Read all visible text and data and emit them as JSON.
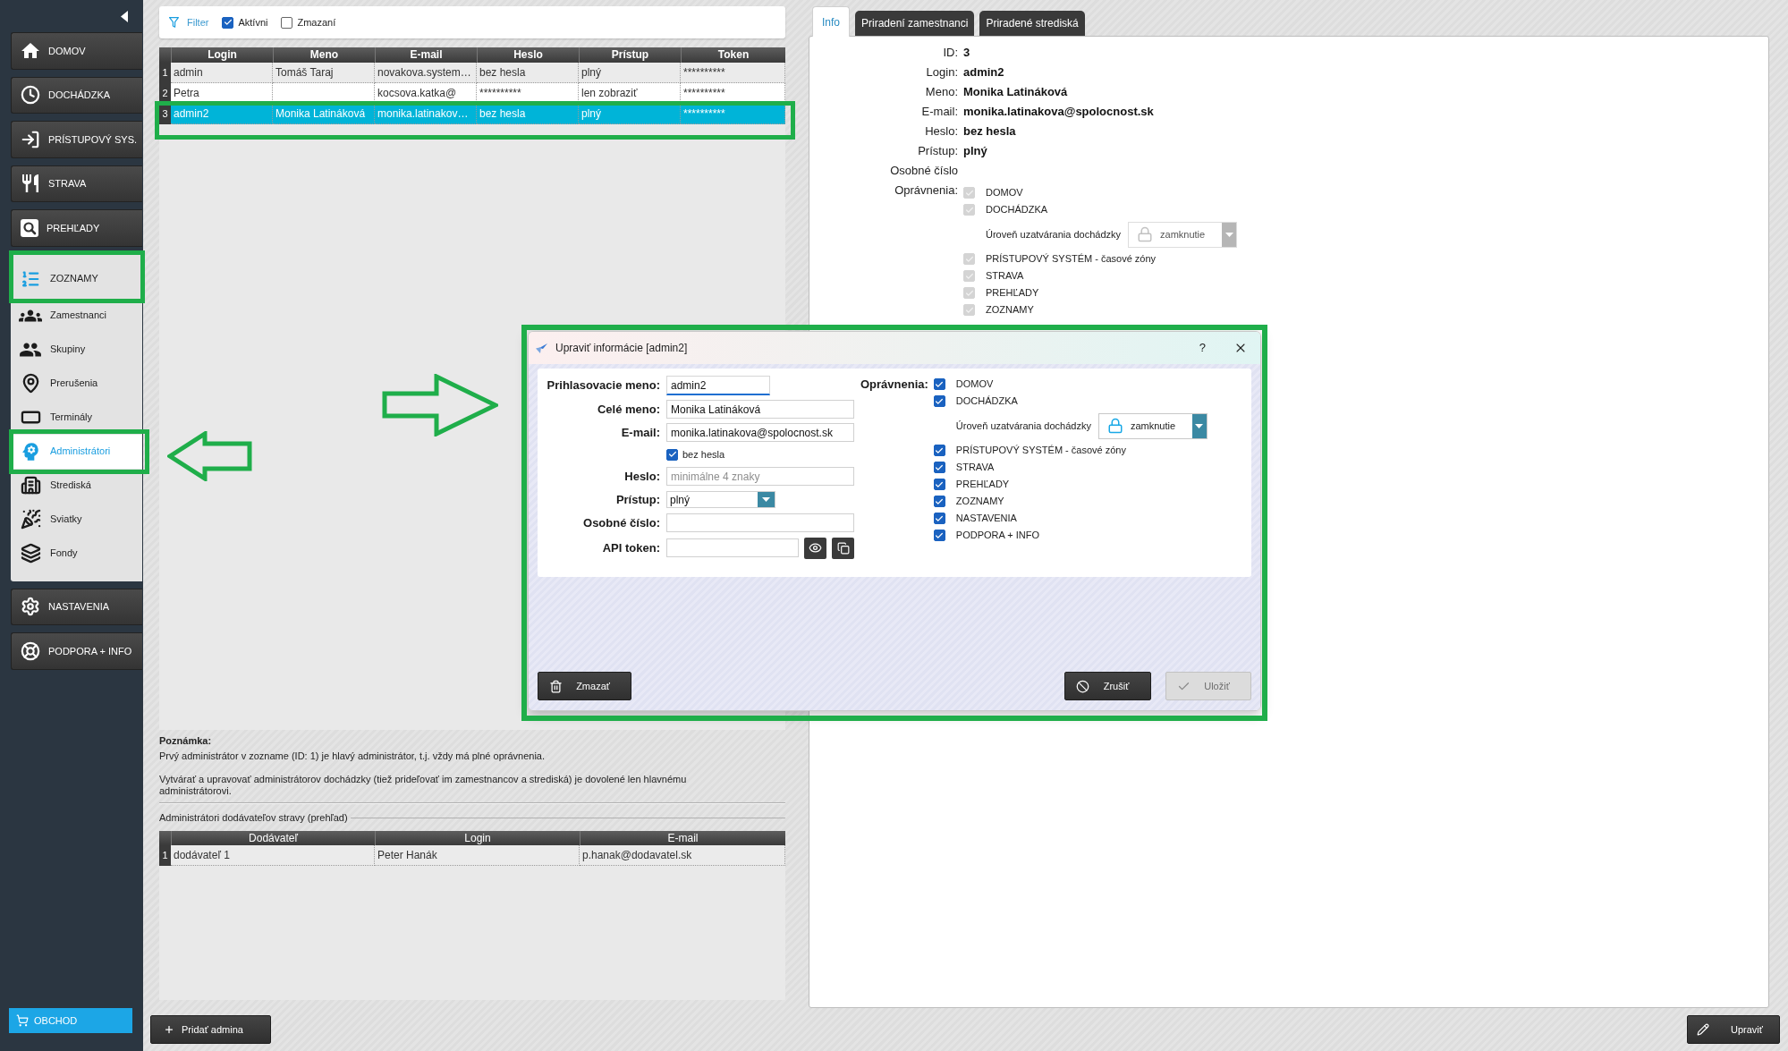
{
  "sidebar": {
    "items": [
      {
        "label": "DOMOV",
        "expanded": false
      },
      {
        "label": "DOCHÁDZKA",
        "expanded": false
      },
      {
        "label": "PRÍSTUPOVÝ SYS.",
        "expanded": false
      },
      {
        "label": "STRAVA",
        "expanded": false
      },
      {
        "label": "PREHĽADY",
        "expanded": false
      },
      {
        "label": "ZOZNAMY",
        "expanded": true,
        "children": [
          {
            "label": "Zamestnanci",
            "selected": false
          },
          {
            "label": "Skupiny",
            "selected": false
          },
          {
            "label": "Prerušenia",
            "selected": false
          },
          {
            "label": "Terminály",
            "selected": false
          },
          {
            "label": "Administrátori",
            "selected": true
          },
          {
            "label": "Strediská",
            "selected": false
          },
          {
            "label": "Sviatky",
            "selected": false
          },
          {
            "label": "Fondy",
            "selected": false
          }
        ]
      },
      {
        "label": "NASTAVENIA",
        "expanded": false
      },
      {
        "label": "PODPORA + INFO",
        "expanded": false
      }
    ],
    "shop_button": {
      "label": "OBCHOD"
    }
  },
  "filter": {
    "label": "Filter",
    "options": [
      {
        "label": "Aktívni",
        "checked": true
      },
      {
        "label": "Zmazaní",
        "checked": false
      }
    ]
  },
  "admins_table": {
    "columns": [
      "Login",
      "Meno",
      "E-mail",
      "Heslo",
      "Prístup",
      "Token"
    ],
    "rows": [
      {
        "number": "1",
        "selected": false,
        "login": "admin",
        "name": "Tomáš Taraj",
        "email": "novakova.system…",
        "password": "bez hesla",
        "access": "plný",
        "token": "**********"
      },
      {
        "number": "2",
        "selected": false,
        "login": "Petra",
        "email": "kocsova.katka@",
        "password": "**********",
        "access": "len zobraziť",
        "token": "**********"
      },
      {
        "number": "3",
        "selected": true,
        "login": "admin2",
        "name": "Monika Latináková",
        "email": "monika.latinakov…",
        "password": "bez hesla",
        "access": "plný",
        "token": "**********"
      }
    ]
  },
  "note": {
    "title": "Poznámka:",
    "paragraphs": [
      "Prvý administrátor v zozname (ID: 1) je hlavý administrátor, t.j. vždy má plné oprávnenia.",
      "Vytvárať a upravovať administrátorov dochádzky (tiež prideľovať im zamestnancov a strediská) je dovolené len hlavnému administrátorovi."
    ]
  },
  "suppliers": {
    "title": "Administrátori dodávateľov stravy (prehľad)",
    "columns": [
      "Dodávateľ",
      "Login",
      "E-mail"
    ],
    "rows": [
      {
        "number": "1",
        "cells": [
          "dodávateľ 1",
          "Peter Hanák",
          "p.hanak@dodavatel.sk"
        ]
      }
    ]
  },
  "add_button": {
    "label": "Pridať admina"
  },
  "detail": {
    "tabs": [
      {
        "label": "Info",
        "selected": true
      },
      {
        "label": "Priradení zamestnanci",
        "selected": false
      },
      {
        "label": "Priradené strediská",
        "selected": false
      }
    ],
    "fields": [
      {
        "label": "ID:",
        "value": "3"
      },
      {
        "label": "Login:",
        "value": "admin2"
      },
      {
        "label": "Meno:",
        "value": "Monika Latináková"
      },
      {
        "label": "E-mail:",
        "value": "monika.latinakova@spolocnost.sk"
      },
      {
        "label": "Heslo:",
        "value": "bez hesla"
      },
      {
        "label": "Prístup:",
        "value": "plný"
      },
      {
        "label": "Osobné číslo"
      }
    ],
    "permissions": {
      "label": "Oprávnenia:",
      "items": [
        {
          "label": "DOMOV",
          "checked": true,
          "disabled": true
        },
        {
          "label": "DOCHÁDZKA",
          "checked": true,
          "disabled": true,
          "lock_level": {
            "label": "Úroveň uzatvárania dochádzky",
            "value": "zamknutie",
            "disabled": true
          }
        },
        {
          "label": "PRÍSTUPOVÝ SYSTÉM - časové zóny",
          "checked": true,
          "disabled": true
        },
        {
          "label": "STRAVA",
          "checked": true,
          "disabled": true
        },
        {
          "label": "PREHĽADY",
          "checked": true,
          "disabled": true
        },
        {
          "label": "ZOZNAMY",
          "checked": true,
          "disabled": true
        }
      ]
    },
    "edit_button": {
      "label": "Upraviť"
    }
  },
  "dialog": {
    "title": "Upraviť informácie [admin2]",
    "help": "?",
    "fields": [
      {
        "kind": "text",
        "label": "Prihlasovacie meno:",
        "value": "admin2",
        "focused": true
      },
      {
        "kind": "text",
        "label": "Celé meno:",
        "value": "Monika Latináková",
        "focused": false
      },
      {
        "kind": "text",
        "label": "E-mail:",
        "value": "monika.latinakova@spolocnost.sk",
        "focused": false
      },
      {
        "kind": "checkbox",
        "label": "bez hesla",
        "checked": true
      },
      {
        "kind": "text",
        "label": "Heslo:",
        "placeholder": "minimálne 4 znaky",
        "focused": false
      },
      {
        "kind": "select",
        "label": "Prístup:",
        "value": "plný"
      },
      {
        "kind": "text",
        "label": "Osobné číslo:",
        "focused": false
      },
      {
        "kind": "token",
        "label": "API token:"
      }
    ],
    "permissions": {
      "label": "Oprávnenia:",
      "items": [
        {
          "label": "DOMOV",
          "checked": true,
          "disabled": false
        },
        {
          "label": "DOCHÁDZKA",
          "checked": true,
          "disabled": false,
          "lock_level": {
            "label": "Úroveň uzatvárania dochádzky",
            "value": "zamknutie",
            "disabled": false
          }
        },
        {
          "label": "PRÍSTUPOVÝ SYSTÉM - časové zóny",
          "checked": true,
          "disabled": false
        },
        {
          "label": "STRAVA",
          "checked": true,
          "disabled": false
        },
        {
          "label": "PREHĽADY",
          "checked": true,
          "disabled": false
        },
        {
          "label": "ZOZNAMY",
          "checked": true,
          "disabled": false
        },
        {
          "label": "NASTAVENIA",
          "checked": true,
          "disabled": false
        },
        {
          "label": "PODPORA + INFO",
          "checked": true,
          "disabled": false
        }
      ]
    },
    "buttons": [
      {
        "kind": "delete",
        "label": "Zmazať",
        "disabled": false
      },
      {
        "kind": "cancel",
        "label": "Zrušiť",
        "disabled": false
      },
      {
        "kind": "save",
        "label": "Uložiť",
        "disabled": true
      }
    ]
  }
}
